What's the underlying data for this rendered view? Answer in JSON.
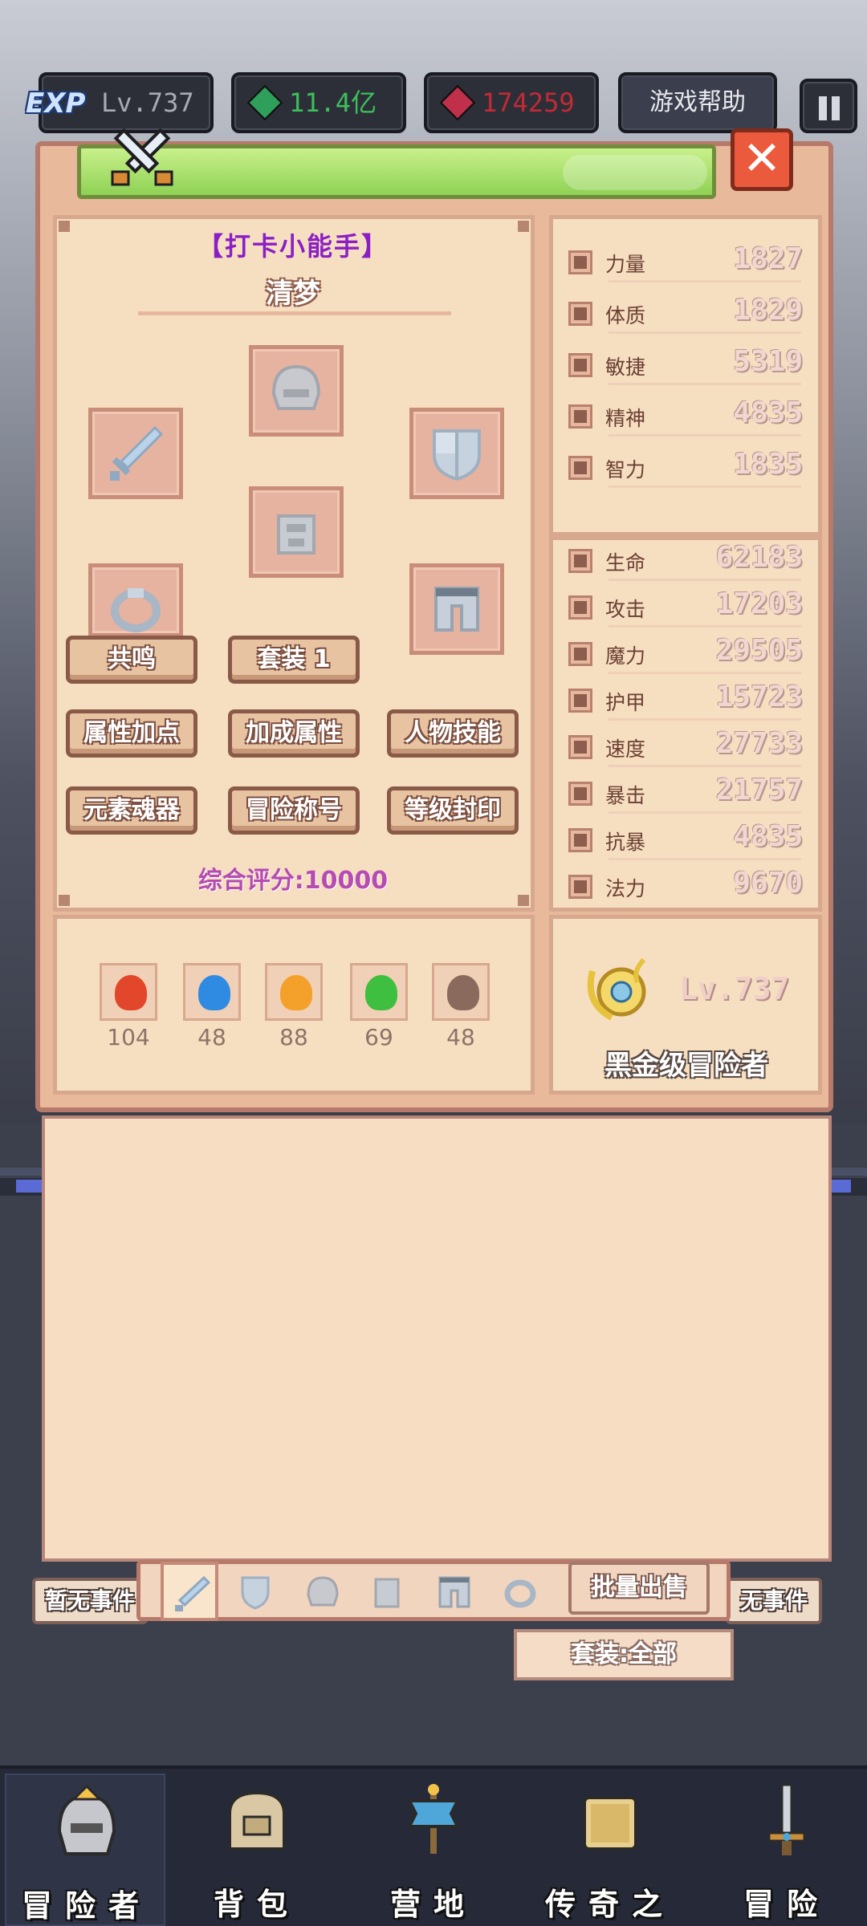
{
  "hud": {
    "exp_badge": "EXP",
    "level": "Lv.737",
    "green_currency": "11.4亿",
    "red_currency": "174259",
    "help_label": "游戏帮助"
  },
  "character": {
    "title": "【打卡小能手】",
    "name": "清梦",
    "buttons": {
      "resonance": "共鸣",
      "set": "套装 1",
      "attr_points": "属性加点",
      "bonus_attr": "加成属性",
      "skills": "人物技能",
      "element_soul": "元素魂器",
      "adventure_title": "冒险称号",
      "level_seal": "等级封印"
    },
    "score": "综合评分:10000"
  },
  "base_stats": [
    {
      "label": "力量",
      "value": "1827"
    },
    {
      "label": "体质",
      "value": "1829"
    },
    {
      "label": "敏捷",
      "value": "5319"
    },
    {
      "label": "精神",
      "value": "4835"
    },
    {
      "label": "智力",
      "value": "1835"
    }
  ],
  "combat_stats": [
    {
      "label": "生命",
      "value": "62183"
    },
    {
      "label": "攻击",
      "value": "17203"
    },
    {
      "label": "魔力",
      "value": "29505"
    },
    {
      "label": "护甲",
      "value": "15723"
    },
    {
      "label": "速度",
      "value": "27733"
    },
    {
      "label": "暴击",
      "value": "21757"
    },
    {
      "label": "抗暴",
      "value": "4835"
    },
    {
      "label": "法力",
      "value": "9670"
    }
  ],
  "elements": [
    {
      "name": "fire-element-icon",
      "value": "104",
      "color": "#e2472c"
    },
    {
      "name": "water-element-icon",
      "value": "48",
      "color": "#2f8be2"
    },
    {
      "name": "thunder-element-icon",
      "value": "88",
      "color": "#f3a12a"
    },
    {
      "name": "wood-element-icon",
      "value": "69",
      "color": "#3fbf3f"
    },
    {
      "name": "dark-element-icon",
      "value": "48",
      "color": "#8b6a5e"
    }
  ],
  "rank": {
    "level": "Lv.737",
    "title": "黑金级冒险者"
  },
  "inventory": {
    "batch_sell": "批量出售",
    "set_filter": "套装:全部",
    "event_left": "暂无事件",
    "event_right": "无事件"
  },
  "nav": [
    {
      "label": "冒险者"
    },
    {
      "label": "背包"
    },
    {
      "label": "营地"
    },
    {
      "label": "传奇之书"
    },
    {
      "label": "冒险"
    }
  ]
}
